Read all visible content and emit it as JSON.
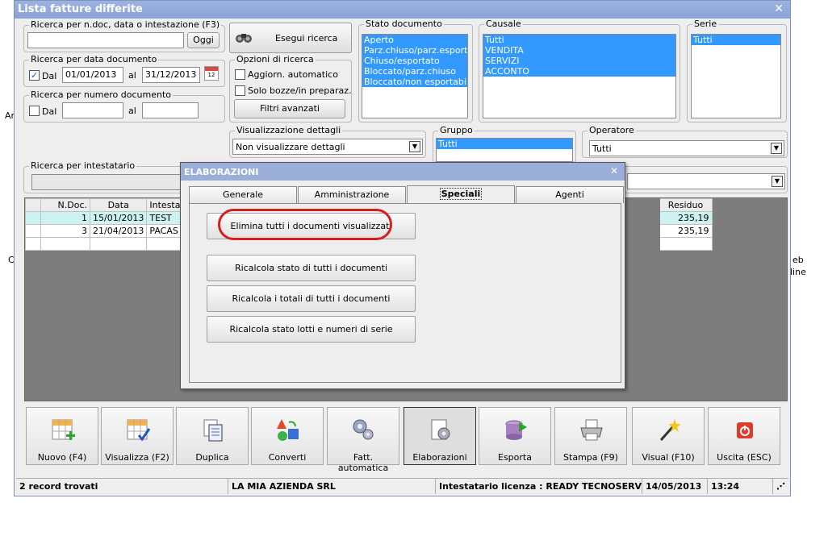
{
  "window": {
    "title": "Lista fatture differite"
  },
  "outside_fragments": {
    "left_1": "Ar",
    "left_2": "C",
    "right_1": "eb",
    "right_2": "line"
  },
  "search_ndoc": {
    "legend": "Ricerca per n.doc, data o intestazione (F3)",
    "value": "",
    "button": "Oggi"
  },
  "execute_search": {
    "label": "Esegui ricerca"
  },
  "search_date": {
    "legend": "Ricerca per data documento",
    "dal_label": "Dal",
    "dal_checked": true,
    "from": "01/01/2013",
    "al_label": "al",
    "to": "31/12/2013"
  },
  "search_number": {
    "legend": "Ricerca per numero documento",
    "dal_label": "Dal",
    "dal_checked": false,
    "from": "",
    "al_label": "al",
    "to": ""
  },
  "search_options": {
    "legend": "Opzioni di ricerca",
    "auto_update": "Aggiorn. automatico",
    "drafts_only": "Solo bozze/in preparaz.",
    "advanced_filters": "Filtri avanzati"
  },
  "stato_documento": {
    "legend": "Stato documento",
    "items": [
      "Aperto",
      "Parz.chiuso/parz.esportato",
      "Chiuso/esportato",
      "Bloccato/parz.chiuso",
      "Bloccato/non esportabile"
    ]
  },
  "causale": {
    "legend": "Causale",
    "items": [
      "Tutti",
      "VENDITA",
      "SERVIZI",
      "ACCONTO"
    ]
  },
  "serie": {
    "legend": "Serie",
    "items": [
      "Tutti"
    ]
  },
  "visualizzazione": {
    "legend": "Visualizzazione dettagli",
    "value": "Non visualizzare dettagli"
  },
  "gruppo": {
    "legend": "Gruppo",
    "items": [
      "Tutti"
    ]
  },
  "operatore": {
    "legend": "Operatore",
    "value": "Tutti"
  },
  "search_intestatario": {
    "legend": "Ricerca per intestatario",
    "value": ""
  },
  "grid": {
    "headers": {
      "ndoc": "N.Doc.",
      "data": "Data",
      "intest": "Intesta",
      "residuo": "Residuo"
    },
    "rows": [
      {
        "ndoc": "1",
        "data": "15/01/2013",
        "intest": "TEST",
        "residuo": "235,19"
      },
      {
        "ndoc": "3",
        "data": "21/04/2013",
        "intest": "PACAS",
        "residuo": "235,19"
      }
    ]
  },
  "dialog": {
    "title": "ELABORAZIONI",
    "tabs": [
      "Generale",
      "Amministrazione",
      "Speciali",
      "Agenti"
    ],
    "active_tab": "Speciali",
    "buttons": [
      "Elimina tutti i documenti visualizzati",
      "Ricalcola stato di tutti i documenti",
      "Ricalcola i totali di tutti i documenti",
      "Ricalcola stato lotti e numeri di serie"
    ]
  },
  "toolbar": [
    {
      "label": "Nuovo (F4)",
      "icon": "new-doc-icon"
    },
    {
      "label": "Visualizza (F2)",
      "icon": "view-doc-icon"
    },
    {
      "label": "Duplica",
      "icon": "duplicate-icon"
    },
    {
      "label": "Converti",
      "icon": "convert-icon"
    },
    {
      "label": "Fatt. automatica",
      "icon": "auto-invoice-icon"
    },
    {
      "label": "Elaborazioni",
      "icon": "process-icon"
    },
    {
      "label": "Esporta",
      "icon": "export-icon"
    },
    {
      "label": "Stampa (F9)",
      "icon": "printer-icon"
    },
    {
      "label": "Visual (F10)",
      "icon": "magic-wand-icon"
    },
    {
      "label": "Uscita (ESC)",
      "icon": "exit-icon"
    }
  ],
  "status": {
    "records": "2 record trovati",
    "company": "LA MIA AZIENDA SRL",
    "license": "Intestatario licenza : READY TECNOSERVICE S",
    "date": "14/05/2013",
    "time": "13:24"
  },
  "colors": {
    "selection": "#3399ff",
    "title": "#9cb2e2",
    "highlight_ring": "#d62020",
    "row_highlight": "#ccf2f2"
  }
}
